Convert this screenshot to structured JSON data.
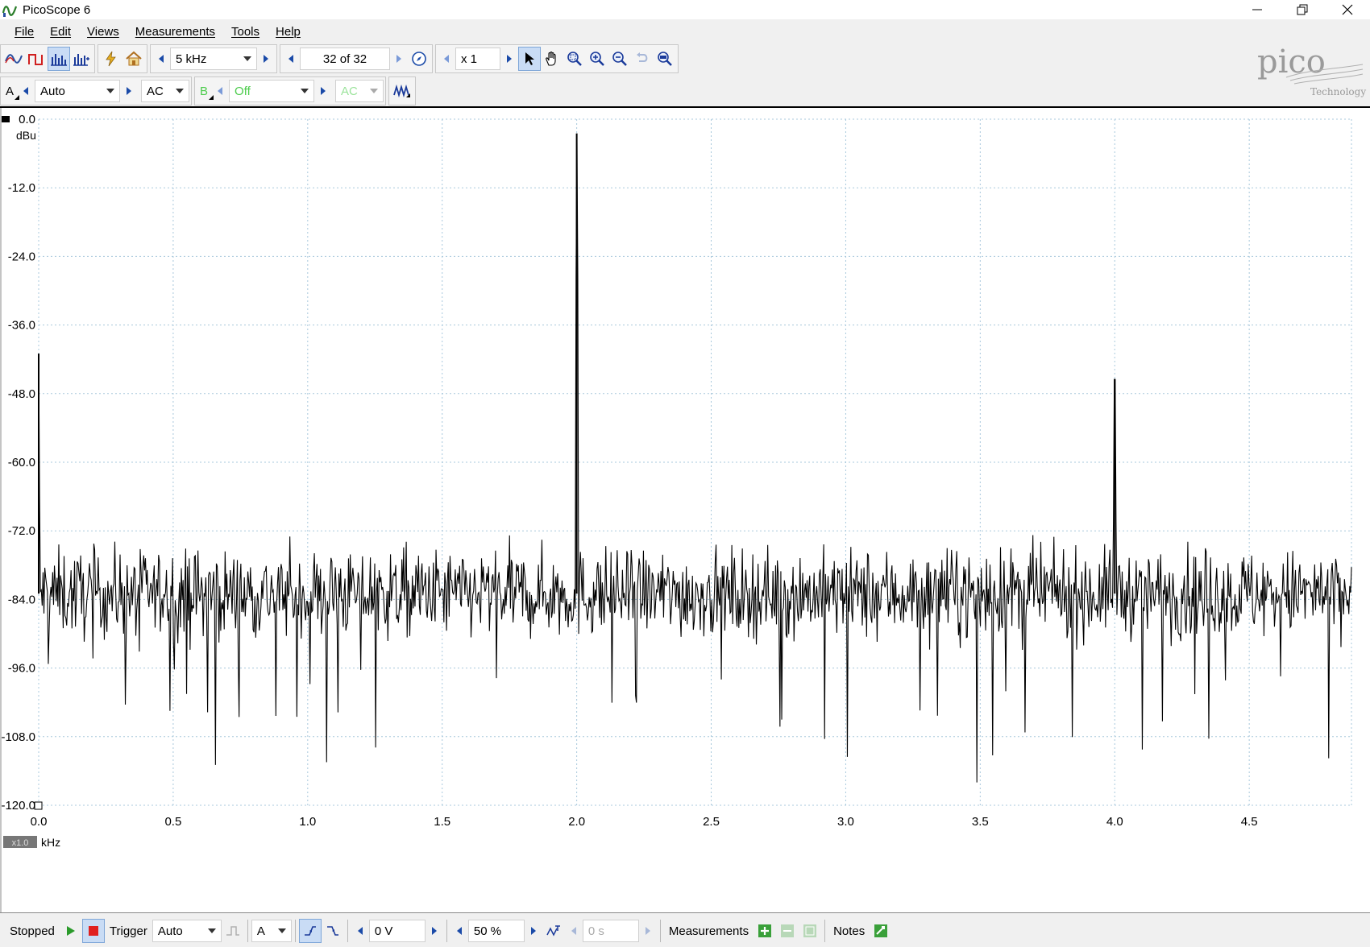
{
  "window": {
    "title": "PicoScope 6"
  },
  "menu": [
    "File",
    "Edit",
    "Views",
    "Measurements",
    "Tools",
    "Help"
  ],
  "toolbar": {
    "timebase": "5 kHz",
    "capture_index": "32 of 32",
    "zoom_factor": "x 1"
  },
  "channel_a": {
    "label": "A",
    "range": "Auto",
    "coupling": "AC"
  },
  "channel_b": {
    "label": "B",
    "range": "Off",
    "coupling": "AC"
  },
  "logo": {
    "brand": "pico",
    "sub": "Technology"
  },
  "scope": {
    "y_unit": "dBu",
    "x_unit": "kHz",
    "x_zoom_badge": "x1.0"
  },
  "chart_data": {
    "type": "line",
    "xlabel": "kHz",
    "ylabel": "dBu",
    "xlim": [
      0.0,
      4.88
    ],
    "ylim": [
      -120.0,
      0.0
    ],
    "y_ticks": [
      "0.0",
      "-12.0",
      "-24.0",
      "-36.0",
      "-48.0",
      "-60.0",
      "-72.0",
      "-84.0",
      "-96.0",
      "-108.0",
      "-120.0"
    ],
    "x_ticks": [
      "0.0",
      "0.5",
      "1.0",
      "1.5",
      "2.0",
      "2.5",
      "3.0",
      "3.5",
      "4.0",
      "4.5"
    ],
    "grid": true,
    "noise_floor_db": -83,
    "series": [
      {
        "peaks": [
          {
            "x": 0.0,
            "y": -41.0
          },
          {
            "x": 2.0,
            "y": -2.5
          },
          {
            "x": 4.0,
            "y": -45.5
          }
        ]
      }
    ]
  },
  "status": {
    "state": "Stopped",
    "trigger_label": "Trigger",
    "trigger_mode": "Auto",
    "trigger_channel": "A",
    "threshold": "0 V",
    "pre_trigger": "50 %",
    "delay": "0 s",
    "measurements_label": "Measurements",
    "notes_label": "Notes"
  },
  "colors": {
    "trace": "#000000",
    "grid": "#a8c8dc",
    "active_button": "#c9dcf5",
    "channel_b": "#4ccc4c"
  }
}
